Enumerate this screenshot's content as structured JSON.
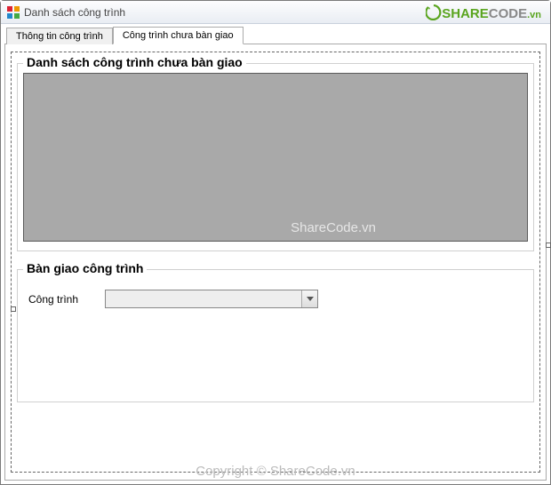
{
  "window": {
    "title": "Danh sách công trình"
  },
  "tabs": {
    "info": "Thông tin công trình",
    "pending": "Công trình chưa bàn giao"
  },
  "group1": {
    "title": "Danh sách công trình chưa bàn giao",
    "grid_watermark": "ShareCode.vn"
  },
  "group2": {
    "title": "Bàn giao công trình",
    "combo_label": "Công trình",
    "combo_value": ""
  },
  "footer_watermark": "Copyright © ShareCode.vn",
  "logo": {
    "share": "SHARE",
    "code": "CODE",
    "tld": ".vn"
  }
}
